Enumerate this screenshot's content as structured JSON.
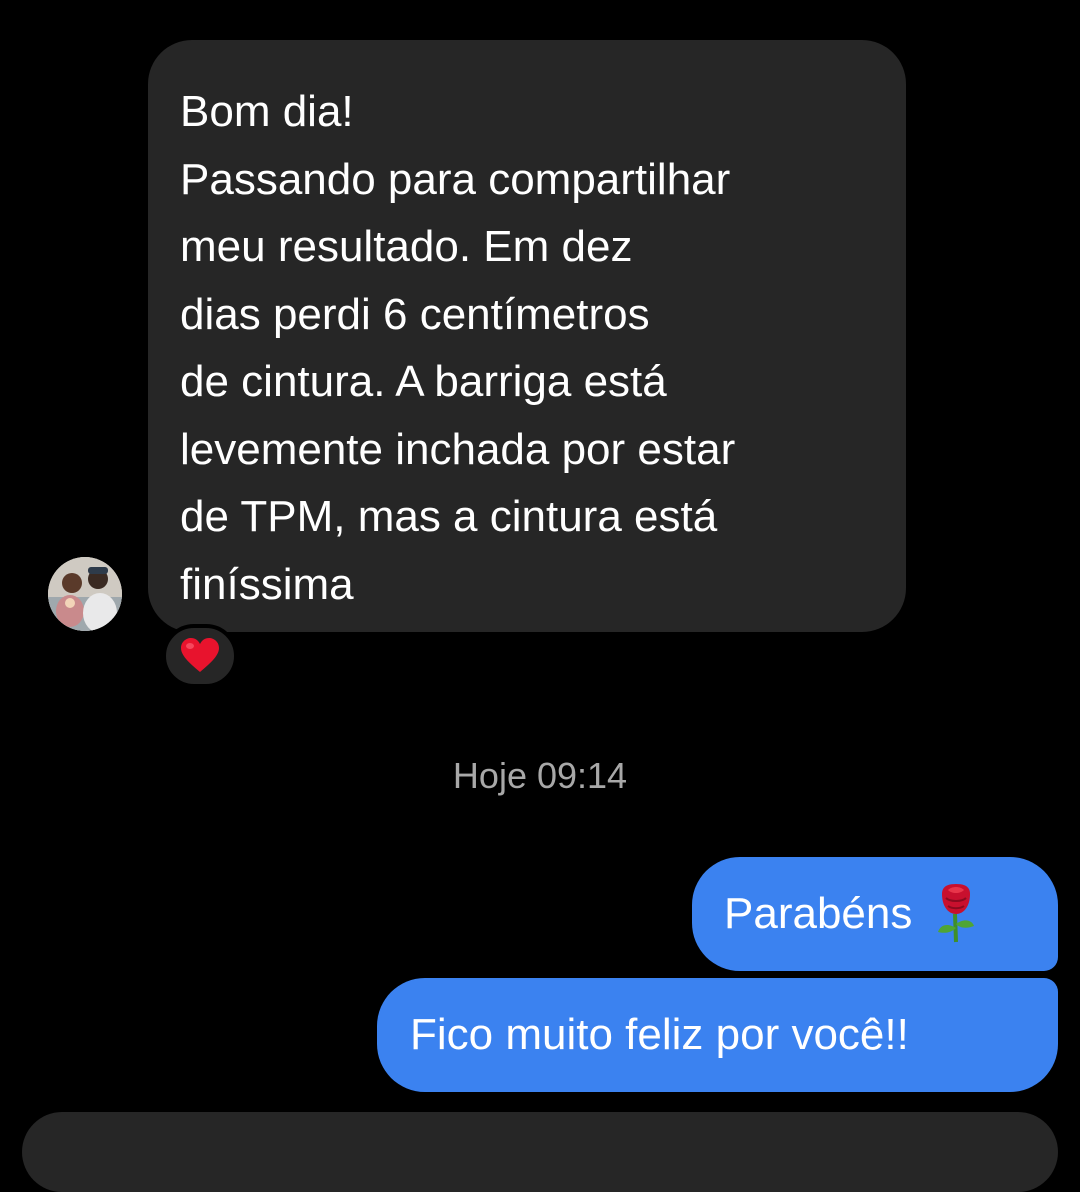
{
  "conversation": {
    "incoming_message": {
      "lines": [
        "Bom dia!",
        "Passando para compartilhar",
        "meu resultado. Em dez",
        "dias perdi 6 centímetros",
        "de cintura. A barriga está",
        "levemente inchada por estar",
        "de TPM, mas a cintura está",
        "finíssima"
      ],
      "reaction": "heart-icon"
    },
    "timestamp": "Hoje 09:14",
    "outgoing_messages": [
      {
        "text": "Parabéns",
        "icon": "rose-icon"
      },
      {
        "text": "Fico muito feliz por você!!"
      }
    ]
  },
  "colors": {
    "background": "#000000",
    "incoming_bubble": "#262626",
    "outgoing_bubble": "#3b82f0",
    "timestamp_text": "#a8a8a8",
    "heart": "#e8132d"
  }
}
